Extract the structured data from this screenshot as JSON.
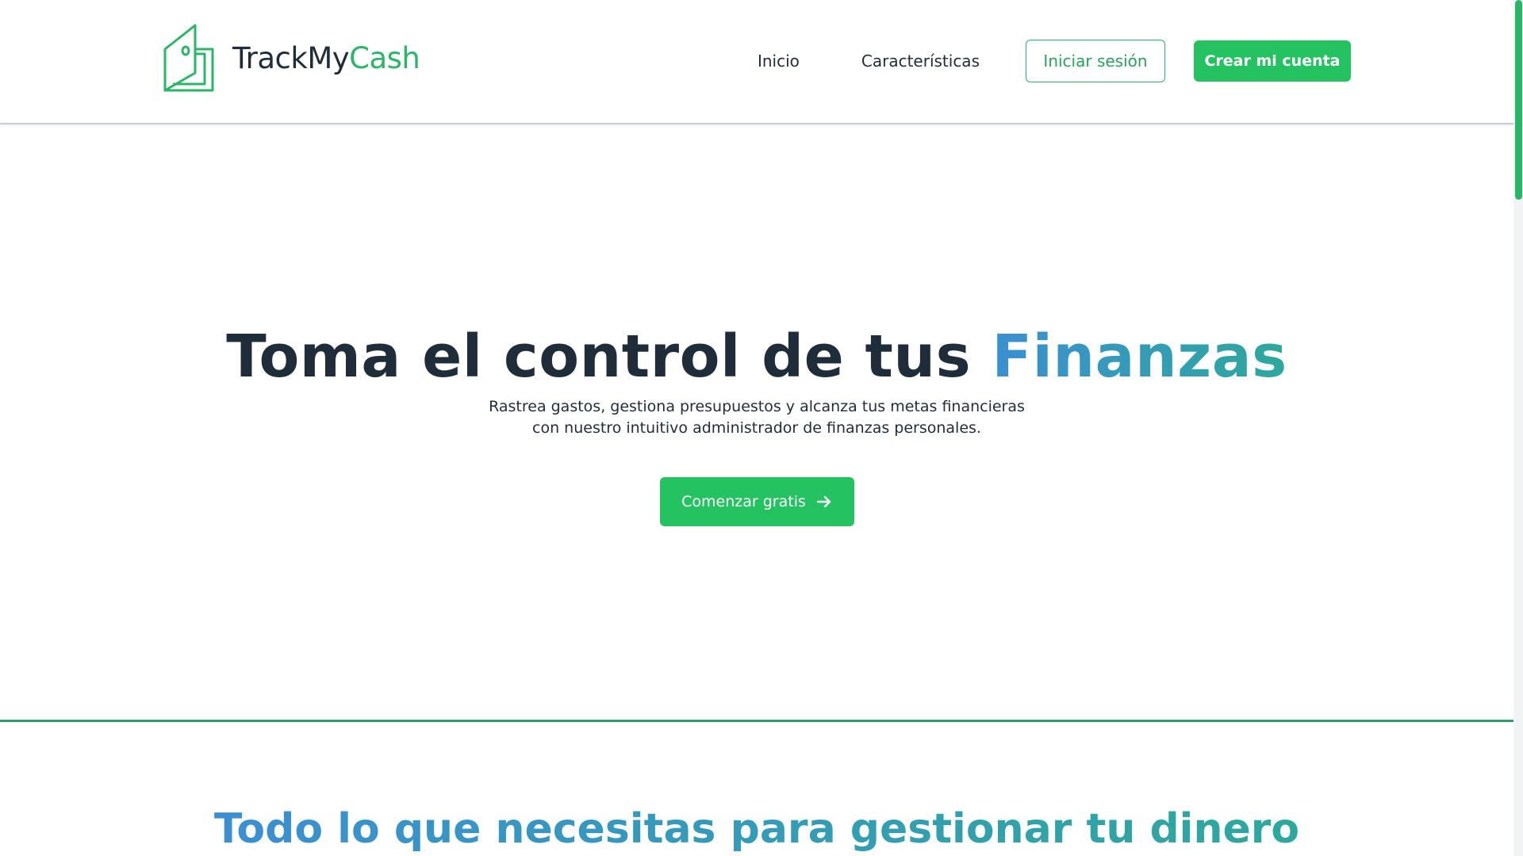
{
  "header": {
    "brand": {
      "name_part1": "TrackMy",
      "name_part2": "Cash",
      "logo_icon": "wallet-icon"
    },
    "nav": {
      "inicio": "Inicio",
      "caracteristicas": "Características",
      "login": "Iniciar sesión",
      "signup": "Crear mi cuenta"
    }
  },
  "page_load_progress": 0.2,
  "hero": {
    "title_part1": "Toma el control de tus ",
    "title_part2": "Finanzas",
    "subtitle_line1": "Rastrea gastos, gestiona presupuestos y alcanza tus metas financieras",
    "subtitle_line2": "con nuestro intuitivo administrador de finanzas personales.",
    "cta_label": "Comenzar gratis",
    "cta_icon": "arrow-right-icon"
  },
  "features": {
    "title": "Todo lo que necesitas para gestionar tu dinero"
  },
  "colors": {
    "brand_green": "#25c261",
    "text_dark": "#1f2d3a",
    "gradient_start": "#3b8fd1",
    "gradient_end": "#2ea89c"
  }
}
